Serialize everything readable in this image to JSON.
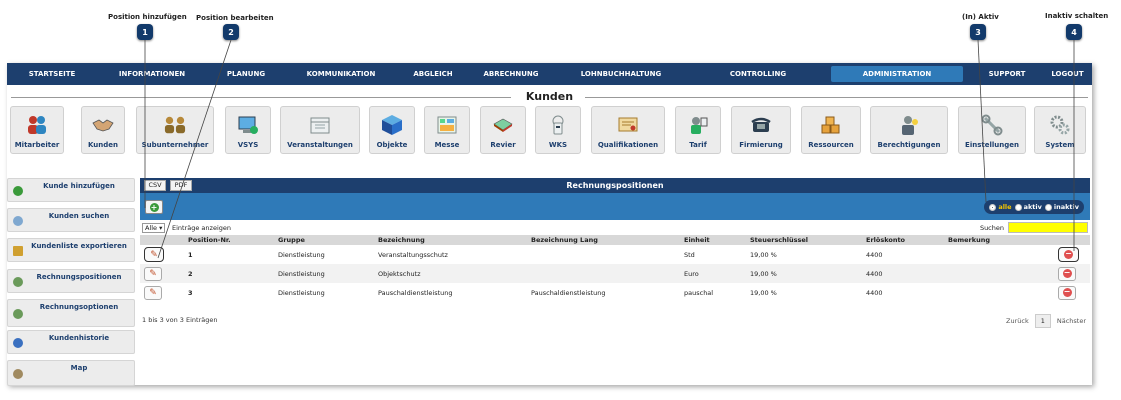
{
  "callouts": [
    {
      "num": "1",
      "label": "Position hinzufügen"
    },
    {
      "num": "2",
      "label": "Position bearbeiten"
    },
    {
      "num": "3",
      "label": "(In) Aktiv"
    },
    {
      "num": "4",
      "label": "Inaktiv schalten"
    }
  ],
  "topnav": [
    {
      "label": "STARTSEITE"
    },
    {
      "label": "INFORMATIONEN"
    },
    {
      "label": "PLANUNG"
    },
    {
      "label": "KOMMUNIKATION"
    },
    {
      "label": "ABGLEICH"
    },
    {
      "label": "ABRECHNUNG"
    },
    {
      "label": "LOHNBUCHHALTUNG"
    },
    {
      "label": "CONTROLLING"
    },
    {
      "label": "ADMINISTRATION"
    },
    {
      "label": "SUPPORT"
    },
    {
      "label": "LOGOUT"
    }
  ],
  "section_title": "Kunden",
  "tiles": [
    {
      "label": "Mitarbeiter",
      "icon": "people-icon"
    },
    {
      "label": "Kunden",
      "icon": "handshake-icon"
    },
    {
      "label": "Subunternehmer",
      "icon": "partners-icon"
    },
    {
      "label": "VSYS",
      "icon": "computer-icon"
    },
    {
      "label": "Veranstaltungen",
      "icon": "calendar-icon"
    },
    {
      "label": "Objekte",
      "icon": "cube-icon"
    },
    {
      "label": "Messe",
      "icon": "floorplan-icon"
    },
    {
      "label": "Revier",
      "icon": "map-icon"
    },
    {
      "label": "WKS",
      "icon": "guard-tour-icon"
    },
    {
      "label": "Qualifikationen",
      "icon": "certificate-icon"
    },
    {
      "label": "Tarif",
      "icon": "tariff-icon"
    },
    {
      "label": "Firmierung",
      "icon": "phone-icon"
    },
    {
      "label": "Ressourcen",
      "icon": "boxes-icon"
    },
    {
      "label": "Berechtigungen",
      "icon": "user-key-icon"
    },
    {
      "label": "Einstellungen",
      "icon": "wrench-icon"
    },
    {
      "label": "System",
      "icon": "gears-icon"
    }
  ],
  "sidebar": [
    {
      "label": "Kunde hinzufügen",
      "icon": "add-icon",
      "color": "#3a9a3a"
    },
    {
      "label": "Kunden suchen",
      "icon": "search-icon",
      "color": "#7fa8d0"
    },
    {
      "label": "Kundenliste exportieren",
      "icon": "export-icon",
      "color": "#d0a030"
    },
    {
      "label": "Rechnungspositionen",
      "icon": "list-icon",
      "color": "#6a9a5a"
    },
    {
      "label": "Rechnungsoptionen",
      "icon": "options-icon",
      "color": "#6a9a5a"
    },
    {
      "label": "Kundenhistorie",
      "icon": "info-icon",
      "color": "#3a70c0"
    },
    {
      "label": "Map",
      "icon": "map-pin-icon",
      "color": "#a08a60"
    }
  ],
  "panel": {
    "title": "Rechnungspositionen",
    "csv_label": "CSV",
    "pdf_label": "PDF",
    "add_symbol": "+",
    "filter": {
      "options": [
        {
          "label": "alle",
          "selected": true
        },
        {
          "label": "aktiv",
          "selected": false
        },
        {
          "label": "inaktiv",
          "selected": false
        }
      ]
    },
    "length_select": "Alle",
    "length_text": "Einträge anzeigen",
    "search_label": "Suchen",
    "search_value": "",
    "columns": [
      "",
      "Position-Nr.",
      "Gruppe",
      "Bezeichnung",
      "Bezeichnung Lang",
      "Einheit",
      "Steuerschlüssel",
      "Erlöskonto",
      "Bemerkung",
      ""
    ],
    "rows": [
      {
        "nr": "1",
        "gruppe": "Dienstleistung",
        "bezeichnung": "Veranstaltungsschutz",
        "lang": "",
        "einheit": "Std",
        "steuer": "19,00 %",
        "konto": "4400",
        "bemerkung": ""
      },
      {
        "nr": "2",
        "gruppe": "Dienstleistung",
        "bezeichnung": "Objektschutz",
        "lang": "",
        "einheit": "Euro",
        "steuer": "19,00 %",
        "konto": "4400",
        "bemerkung": ""
      },
      {
        "nr": "3",
        "gruppe": "Dienstleistung",
        "bezeichnung": "Pauschaldienstleistung",
        "lang": "Pauschaldienstleistung",
        "einheit": "pauschal",
        "steuer": "19,00 %",
        "konto": "4400",
        "bemerkung": ""
      }
    ],
    "info": "1 bis 3 von 3 Einträgen",
    "pager": {
      "prev": "Zurück",
      "page": "1",
      "next": "Nächster"
    },
    "delete_symbol": "−",
    "edit_symbol": "✎"
  }
}
